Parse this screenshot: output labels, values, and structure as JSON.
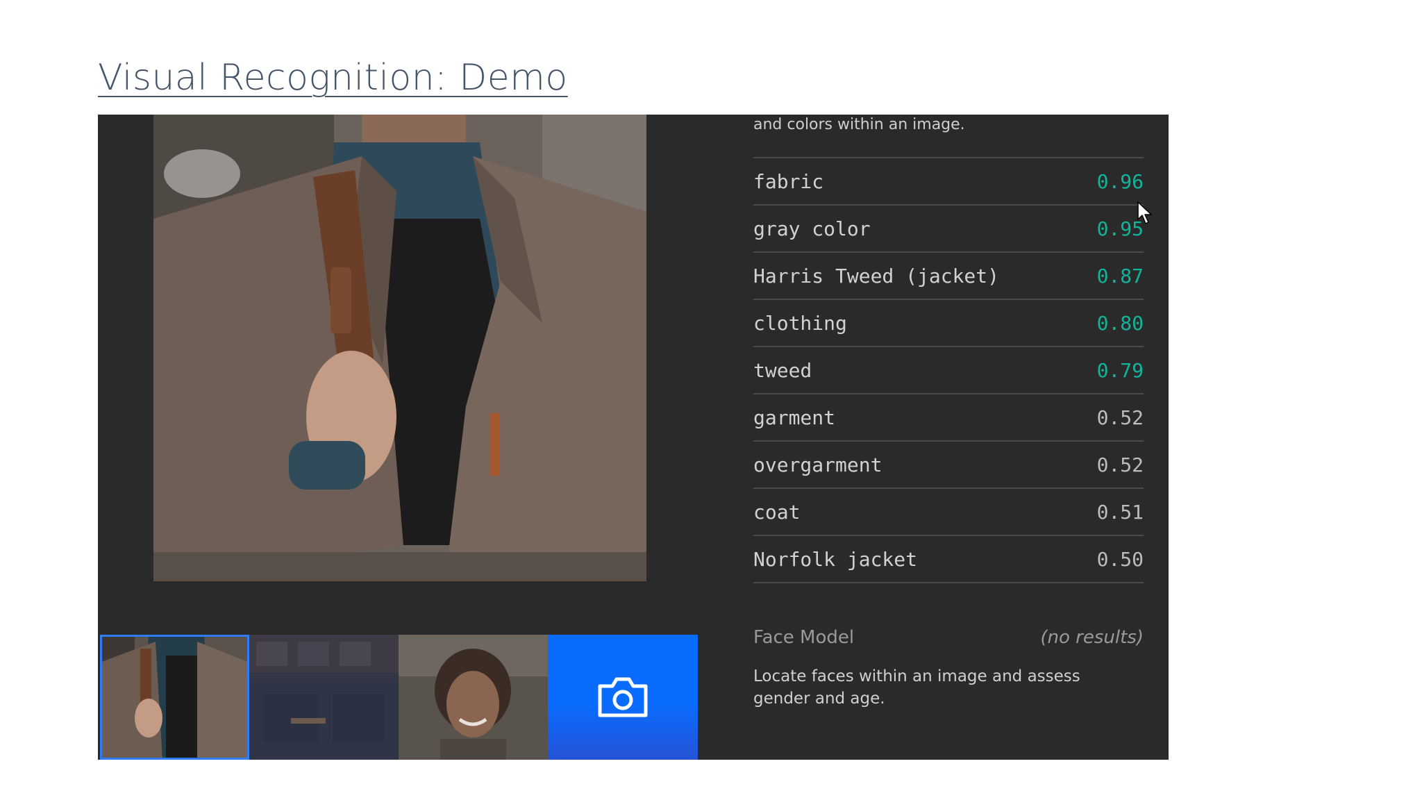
{
  "slide": {
    "title": "Visual Recognition: Demo"
  },
  "demo": {
    "intro_text": "and colors within an image.",
    "results": [
      {
        "label": "fabric",
        "score": "0.96",
        "highlight": true
      },
      {
        "label": "gray color",
        "score": "0.95",
        "highlight": true
      },
      {
        "label": "Harris Tweed (jacket)",
        "score": "0.87",
        "highlight": true
      },
      {
        "label": "clothing",
        "score": "0.80",
        "highlight": true
      },
      {
        "label": "tweed",
        "score": "0.79",
        "highlight": true
      },
      {
        "label": "garment",
        "score": "0.52",
        "highlight": false
      },
      {
        "label": "overgarment",
        "score": "0.52",
        "highlight": false
      },
      {
        "label": "coat",
        "score": "0.51",
        "highlight": false
      },
      {
        "label": "Norfolk jacket",
        "score": "0.50",
        "highlight": false
      }
    ],
    "face_model": {
      "title": "Face Model",
      "status": "(no results)",
      "description": "Locate faces within an image and assess gender and age."
    },
    "thumbnails": [
      {
        "icon": "man-in-tweed-jacket-image",
        "selected": true
      },
      {
        "icon": "storefront-image",
        "selected": false
      },
      {
        "icon": "smiling-woman-image",
        "selected": false
      },
      {
        "icon": "camera-icon",
        "selected": false
      }
    ]
  },
  "colors": {
    "panel_bg": "#2a2a2a",
    "high_score": "#11b59b",
    "camera_tile": "#0a6cff",
    "title": "#44546a"
  }
}
